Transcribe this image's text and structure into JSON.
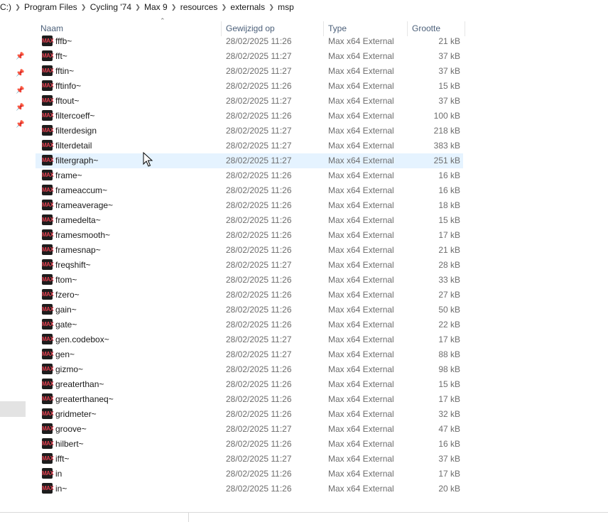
{
  "breadcrumb": [
    "C:)",
    "Program Files",
    "Cycling '74",
    "Max 9",
    "resources",
    "externals",
    "msp"
  ],
  "columns": {
    "name": "Naam",
    "date": "Gewijzigd op",
    "type": "Type",
    "size": "Grootte"
  },
  "icon_label": "MAX",
  "files": [
    {
      "name": "fffb~",
      "date": "28/02/2025 11:26",
      "type": "Max x64 External",
      "size": "21 kB"
    },
    {
      "name": "fft~",
      "date": "28/02/2025 11:27",
      "type": "Max x64 External",
      "size": "37 kB"
    },
    {
      "name": "fftin~",
      "date": "28/02/2025 11:27",
      "type": "Max x64 External",
      "size": "37 kB"
    },
    {
      "name": "fftinfo~",
      "date": "28/02/2025 11:26",
      "type": "Max x64 External",
      "size": "15 kB"
    },
    {
      "name": "fftout~",
      "date": "28/02/2025 11:27",
      "type": "Max x64 External",
      "size": "37 kB"
    },
    {
      "name": "filtercoeff~",
      "date": "28/02/2025 11:26",
      "type": "Max x64 External",
      "size": "100 kB"
    },
    {
      "name": "filterdesign",
      "date": "28/02/2025 11:27",
      "type": "Max x64 External",
      "size": "218 kB"
    },
    {
      "name": "filterdetail",
      "date": "28/02/2025 11:27",
      "type": "Max x64 External",
      "size": "383 kB"
    },
    {
      "name": "filtergraph~",
      "date": "28/02/2025 11:27",
      "type": "Max x64 External",
      "size": "251 kB"
    },
    {
      "name": "frame~",
      "date": "28/02/2025 11:26",
      "type": "Max x64 External",
      "size": "16 kB"
    },
    {
      "name": "frameaccum~",
      "date": "28/02/2025 11:26",
      "type": "Max x64 External",
      "size": "16 kB"
    },
    {
      "name": "frameaverage~",
      "date": "28/02/2025 11:26",
      "type": "Max x64 External",
      "size": "18 kB"
    },
    {
      "name": "framedelta~",
      "date": "28/02/2025 11:26",
      "type": "Max x64 External",
      "size": "15 kB"
    },
    {
      "name": "framesmooth~",
      "date": "28/02/2025 11:26",
      "type": "Max x64 External",
      "size": "17 kB"
    },
    {
      "name": "framesnap~",
      "date": "28/02/2025 11:26",
      "type": "Max x64 External",
      "size": "21 kB"
    },
    {
      "name": "freqshift~",
      "date": "28/02/2025 11:27",
      "type": "Max x64 External",
      "size": "28 kB"
    },
    {
      "name": "ftom~",
      "date": "28/02/2025 11:26",
      "type": "Max x64 External",
      "size": "33 kB"
    },
    {
      "name": "fzero~",
      "date": "28/02/2025 11:26",
      "type": "Max x64 External",
      "size": "27 kB"
    },
    {
      "name": "gain~",
      "date": "28/02/2025 11:26",
      "type": "Max x64 External",
      "size": "50 kB"
    },
    {
      "name": "gate~",
      "date": "28/02/2025 11:26",
      "type": "Max x64 External",
      "size": "22 kB"
    },
    {
      "name": "gen.codebox~",
      "date": "28/02/2025 11:27",
      "type": "Max x64 External",
      "size": "17 kB"
    },
    {
      "name": "gen~",
      "date": "28/02/2025 11:27",
      "type": "Max x64 External",
      "size": "88 kB"
    },
    {
      "name": "gizmo~",
      "date": "28/02/2025 11:26",
      "type": "Max x64 External",
      "size": "98 kB"
    },
    {
      "name": "greaterthan~",
      "date": "28/02/2025 11:26",
      "type": "Max x64 External",
      "size": "15 kB"
    },
    {
      "name": "greaterthaneq~",
      "date": "28/02/2025 11:26",
      "type": "Max x64 External",
      "size": "17 kB"
    },
    {
      "name": "gridmeter~",
      "date": "28/02/2025 11:26",
      "type": "Max x64 External",
      "size": "32 kB"
    },
    {
      "name": "groove~",
      "date": "28/02/2025 11:27",
      "type": "Max x64 External",
      "size": "47 kB"
    },
    {
      "name": "hilbert~",
      "date": "28/02/2025 11:26",
      "type": "Max x64 External",
      "size": "16 kB"
    },
    {
      "name": "ifft~",
      "date": "28/02/2025 11:27",
      "type": "Max x64 External",
      "size": "37 kB"
    },
    {
      "name": "in",
      "date": "28/02/2025 11:26",
      "type": "Max x64 External",
      "size": "17 kB"
    },
    {
      "name": "in~",
      "date": "28/02/2025 11:26",
      "type": "Max x64 External",
      "size": "20 kB"
    }
  ],
  "hovered_file": "filtergraph~",
  "colors": {
    "hover_row": "#e5f3ff",
    "header_text": "#4c607a",
    "secondary_text": "#6d6d6d",
    "icon_bg": "#1d1d1d",
    "icon_text": "#e04050"
  },
  "icons": {
    "separator": "chevron-right-icon",
    "pin": "pin-icon",
    "sort": "sort-ascending-icon",
    "file": "max-external-icon"
  }
}
